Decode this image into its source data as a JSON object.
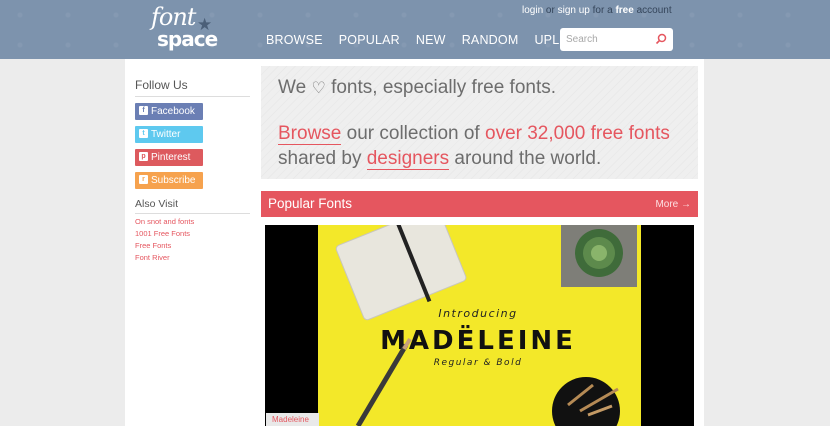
{
  "header": {
    "logo_top": "font",
    "logo_bottom": "space",
    "account": {
      "login": "login",
      "or": "or",
      "signup": "sign up",
      "for_a": "for a",
      "free": "free",
      "account": "account"
    },
    "nav": [
      "BROWSE",
      "POPULAR",
      "NEW",
      "RANDOM",
      "UPLOAD"
    ],
    "search_placeholder": "Search"
  },
  "sidebar": {
    "follow_title": "Follow Us",
    "social": [
      {
        "label": "Facebook",
        "icon": "facebook-icon",
        "glyph": "f",
        "color": "#6b7fb4"
      },
      {
        "label": "Twitter",
        "icon": "twitter-icon",
        "glyph": "t",
        "color": "#5ec9ef"
      },
      {
        "label": "Pinterest",
        "icon": "pinterest-icon",
        "glyph": "p",
        "color": "#dd5a5e"
      },
      {
        "label": "Subscribe",
        "icon": "rss-icon",
        "glyph": "r",
        "color": "#f6a24e"
      }
    ],
    "also_title": "Also Visit",
    "links": [
      "On snot and fonts",
      "1001 Free Fonts",
      "Free Fonts",
      "Font River"
    ]
  },
  "hero": {
    "line1_pre": "We",
    "line1_post": "fonts, especially free fonts.",
    "browse": "Browse",
    "mid1": "our collection of",
    "count": "over 32,000 free fonts",
    "shared": "shared by",
    "designers": "designers",
    "end": "around the world."
  },
  "popular": {
    "title": "Popular Fonts",
    "more": "More →"
  },
  "featured": {
    "intro": "Introducing",
    "name": "MADËLEINE",
    "sub": "Regular & Bold",
    "caption": "Madeleine"
  },
  "colors": {
    "accent": "#e5565f",
    "header": "#7d93ad",
    "featured_bg": "#f3e829"
  }
}
